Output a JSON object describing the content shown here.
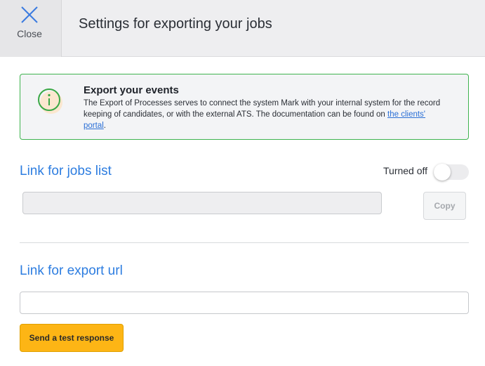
{
  "header": {
    "close_label": "Close",
    "title": "Settings for exporting your jobs"
  },
  "info": {
    "title": "Export your events",
    "text": "The Export of Processes serves to connect the system Mark with your internal system for the record keeping of candidates, or with the external ATS. The documentation can be found on ",
    "link_text": "the clients' portal",
    "suffix": "."
  },
  "jobs_section": {
    "title": "Link for jobs list",
    "toggle_label": "Turned off",
    "toggle_on": false,
    "link_value": "",
    "copy_label": "Copy"
  },
  "export_section": {
    "title": "Link for export url",
    "url_value": "",
    "test_button_label": "Send a test response"
  },
  "colors": {
    "accent": "#2d7de0",
    "success_border": "#3fb34f",
    "button_yellow": "#fdb515"
  }
}
